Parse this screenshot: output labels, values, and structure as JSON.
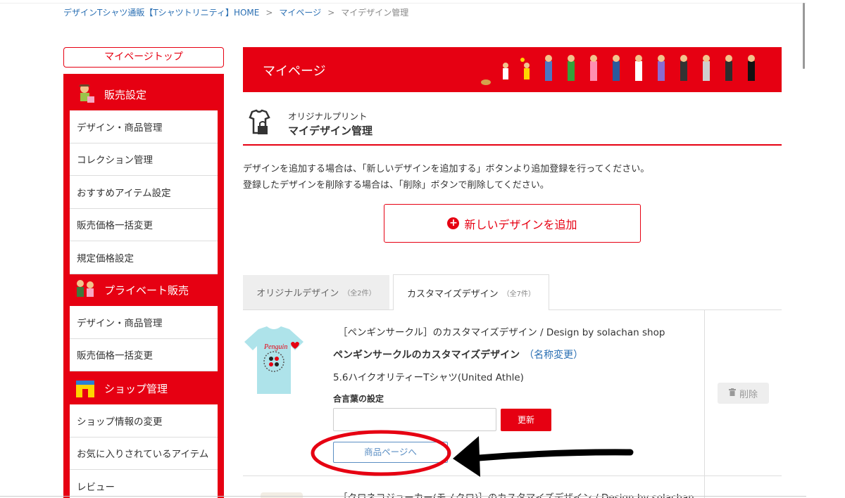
{
  "breadcrumb": {
    "home": "デザインTシャツ通販【Tシャツトリニティ】HOME",
    "sep1": ">",
    "mypage": "マイページ",
    "sep2": ">",
    "current": "マイデザイン管理"
  },
  "sidebar": {
    "top_button": "マイページトップ",
    "sections": [
      {
        "title": "販売設定",
        "items": [
          "デザイン・商品管理",
          "コレクション管理",
          "おすすめアイテム設定",
          "販売価格一括変更",
          "規定価格設定"
        ]
      },
      {
        "title": "プライベート販売",
        "items": [
          "デザイン・商品管理",
          "販売価格一括変更"
        ]
      },
      {
        "title": "ショップ管理",
        "items": [
          "ショップ情報の変更",
          "お気に入りされているアイテム",
          "レビュー"
        ]
      }
    ]
  },
  "banner": {
    "title": "マイページ"
  },
  "section": {
    "subtitle": "オリジナルプリント",
    "title": "マイデザイン管理"
  },
  "description": {
    "line1": "デザインを追加する場合は、「新しいデザインを追加する」ボタンより追加登録を行ってください。",
    "line2": "登録したデザインを削除する場合は、「削除」ボタンで削除してください。"
  },
  "add_button": {
    "label": "新しいデザインを追加"
  },
  "tabs": [
    {
      "label": "オリジナルデザイン",
      "count": "（全2件）"
    },
    {
      "label": "カスタマイズデザイン",
      "count": "（全7件）"
    }
  ],
  "item": {
    "description": "［ペンギンサークル］のカスタマイズデザイン / Design by solachan shop",
    "name": "ペンギンサークルのカスタマイズデザイン",
    "rename": "（名称変更）",
    "product": "5.6ハイクオリティーTシャツ(United Athle)",
    "password_label": "合言葉の設定",
    "password_value": "",
    "update_label": "更新",
    "product_page_label": "商品ページへ",
    "delete_label": "削除",
    "tshirt_text": "Penguin"
  },
  "next_item": {
    "description": "［クロネコジョーカー(モノクロ)］のカスタマイズデザイン / Design by solachan"
  },
  "colors": {
    "brand": "#e60012",
    "link": "#2a6fb3"
  }
}
